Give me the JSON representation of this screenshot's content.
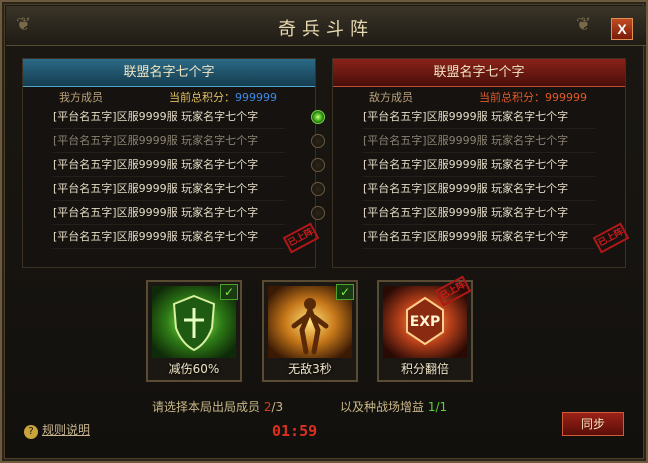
{
  "window": {
    "title": "奇兵斗阵",
    "close_label": "X"
  },
  "left_team": {
    "name": "联盟名字七个字",
    "members_label": "我方成员",
    "score_label": "当前总积分：",
    "score_value": "999999",
    "members": [
      {
        "text": "[平台名五字]区服9999服 玩家名字七个字",
        "dim": false,
        "selected": true
      },
      {
        "text": "[平台名五字]区服9999服 玩家名字七个字",
        "dim": true,
        "selected": false
      },
      {
        "text": "[平台名五字]区服9999服 玩家名字七个字",
        "dim": false,
        "selected": false
      },
      {
        "text": "[平台名五字]区服9999服 玩家名字七个字",
        "dim": false,
        "selected": false
      },
      {
        "text": "[平台名五字]区服9999服 玩家名字七个字",
        "dim": false,
        "selected": false
      },
      {
        "text": "[平台名五字]区服9999服 玩家名字七个字",
        "dim": false,
        "selected": false
      }
    ],
    "stamp": "已上阵"
  },
  "right_team": {
    "name": "联盟名字七个字",
    "members_label": "敌方成员",
    "score_label": "当前总积分：",
    "score_value": "999999",
    "members": [
      {
        "text": "[平台名五字]区服9999服 玩家名字七个字",
        "dim": false
      },
      {
        "text": "[平台名五字]区服9999服 玩家名字七个字",
        "dim": true
      },
      {
        "text": "[平台名五字]区服9999服 玩家名字七个字",
        "dim": false
      },
      {
        "text": "[平台名五字]区服9999服 玩家名字七个字",
        "dim": false
      },
      {
        "text": "[平台名五字]区服9999服 玩家名字七个字",
        "dim": false
      },
      {
        "text": "[平台名五字]区服9999服 玩家名字七个字",
        "dim": false
      }
    ],
    "stamp": "已上阵"
  },
  "buffs": [
    {
      "label": "减伤60%",
      "icon": "shield-icon",
      "checked": true
    },
    {
      "label": "无敌3秒",
      "icon": "invincible-figure-icon",
      "checked": true
    },
    {
      "label": "积分翻倍",
      "icon": "exp-orb-icon",
      "checked": false,
      "stamp": "已上阵"
    }
  ],
  "footer": {
    "select_text": "请选择本局出局成员",
    "select_current": "2",
    "select_total": "/3",
    "bonus_text": "以及种战场增益",
    "bonus_value": "1/1",
    "timer": "01:59",
    "help_label": "规则说明",
    "sync_label": "同步"
  },
  "colors": {
    "accent_blue": "#2c6a86",
    "accent_red": "#8a2218",
    "gold": "#e0c060"
  }
}
